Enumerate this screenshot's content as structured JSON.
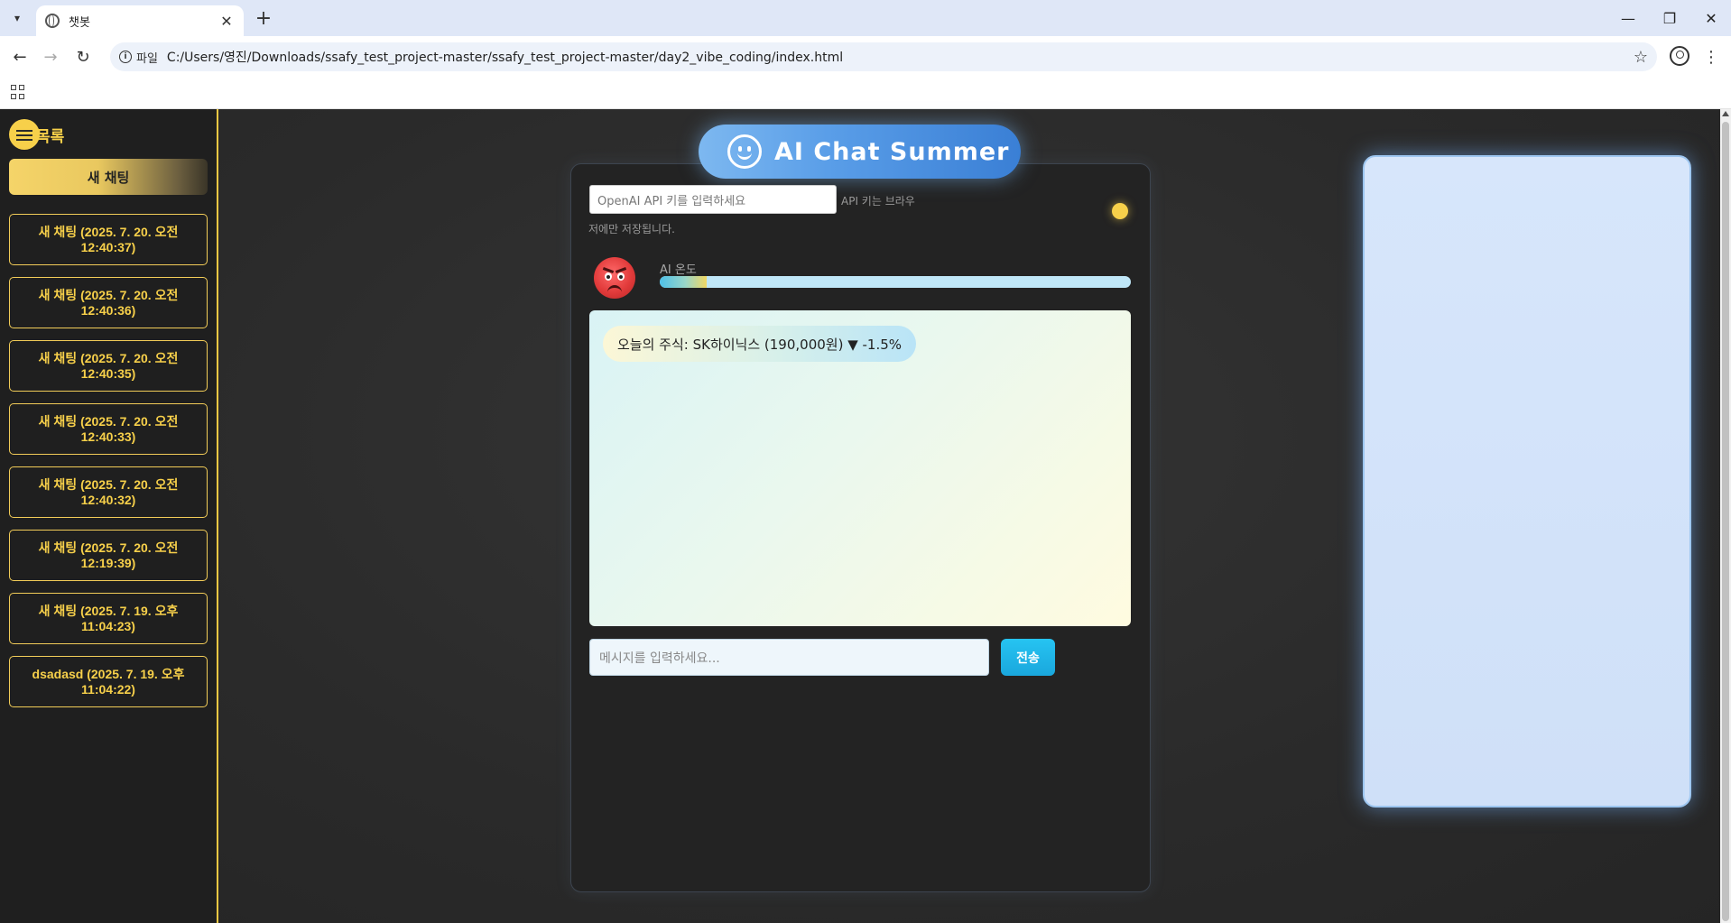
{
  "browser": {
    "tab_title": "챗봇",
    "url_chip": "파일",
    "url": "C:/Users/영진/Downloads/ssafy_test_project-master/ssafy_test_project-master/day2_vibe_coding/index.html"
  },
  "sidebar": {
    "title": "목록",
    "new_chat_label": "새 채팅",
    "items": [
      {
        "label": "새 채팅 (2025. 7. 20. 오전 12:40:37)"
      },
      {
        "label": "새 채팅 (2025. 7. 20. 오전 12:40:36)"
      },
      {
        "label": "새 채팅 (2025. 7. 20. 오전 12:40:35)"
      },
      {
        "label": "새 채팅 (2025. 7. 20. 오전 12:40:33)"
      },
      {
        "label": "새 채팅 (2025. 7. 20. 오전 12:40:32)"
      },
      {
        "label": "새 채팅 (2025. 7. 20. 오전 12:19:39)"
      },
      {
        "label": "새 채팅 (2025. 7. 19. 오후 11:04:23)"
      },
      {
        "label": "dsadasd (2025. 7. 19. 오후 11:04:22)"
      }
    ]
  },
  "chat": {
    "title": "AI Chat Summer",
    "api_placeholder": "OpenAI API 키를 입력하세요",
    "api_note_line1": "API 키는 브라우",
    "api_note_line2": "저에만 저장됩니다.",
    "temperature_label": "AI 온도",
    "temperature_level": 0.1,
    "messages": [
      {
        "text": "오늘의 주식: SK하이닉스 (190,000원) ▼ -1.5%"
      }
    ],
    "input_placeholder": "메시지를 입력하세요...",
    "send_label": "전송"
  },
  "colors": {
    "accent_yellow": "#f7d04a",
    "title_blue": "#3a7fd5",
    "send_cyan": "#1aa7dd"
  },
  "icons": [
    "tab-dropdown-icon",
    "globe-icon",
    "close-icon",
    "plus-icon",
    "minimize-icon",
    "restore-icon",
    "back-icon",
    "forward-icon",
    "reload-icon",
    "info-icon",
    "star-icon",
    "profile-icon",
    "kebab-menu-icon",
    "apps-icon",
    "hamburger-icon",
    "smile-icon",
    "angry-face-icon"
  ]
}
